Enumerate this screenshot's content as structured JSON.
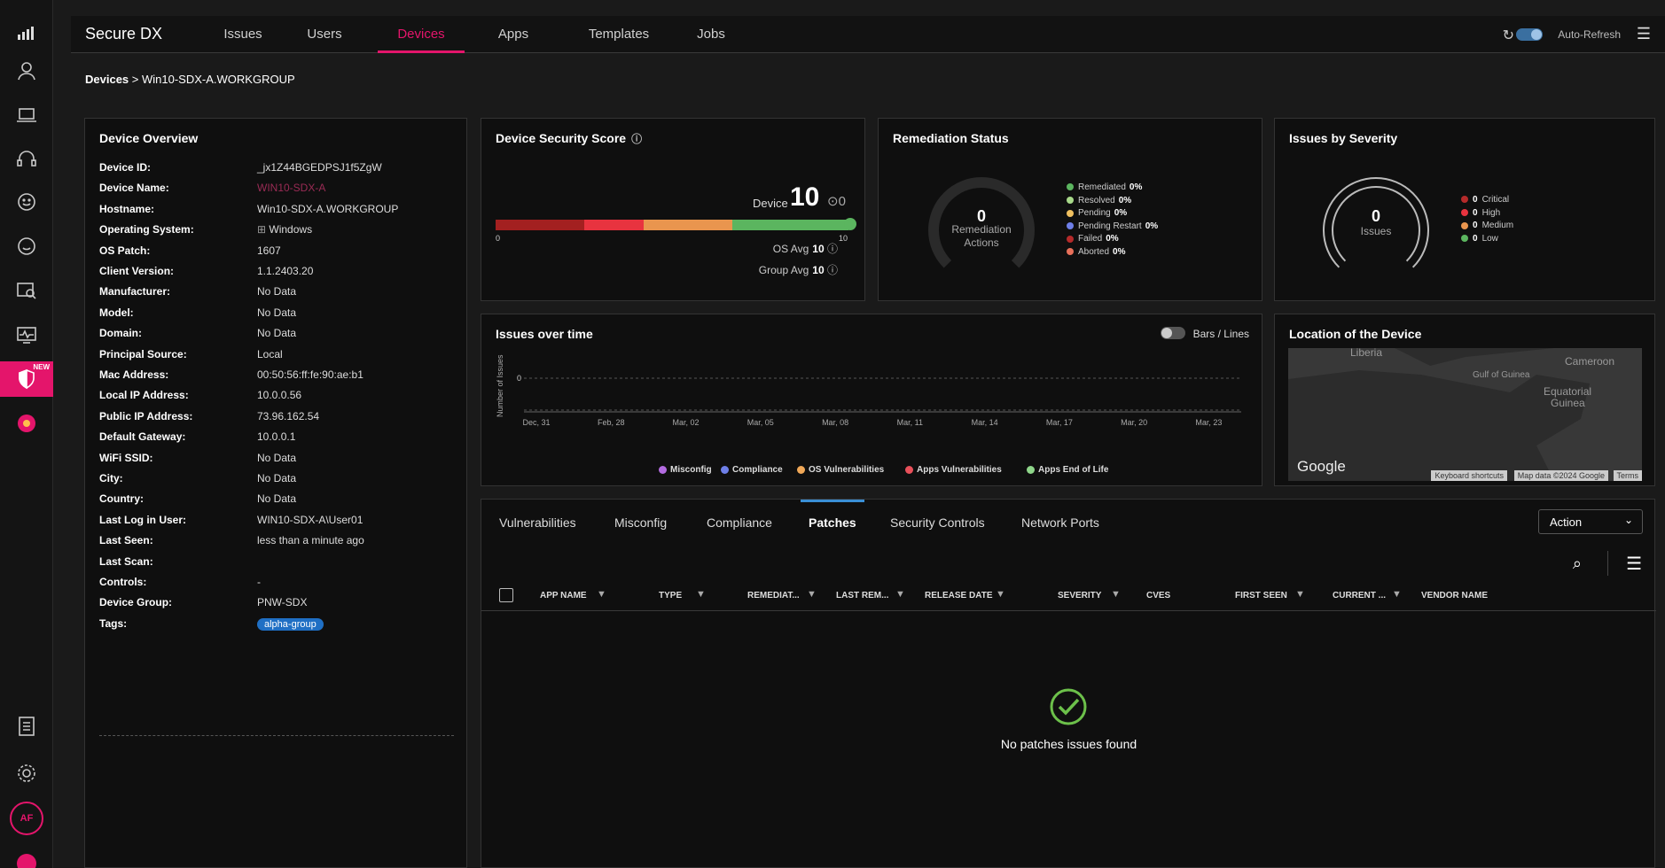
{
  "app": {
    "title": "Secure DX"
  },
  "nav": {
    "tabs": [
      {
        "label": "Issues"
      },
      {
        "label": "Users"
      },
      {
        "label": "Devices",
        "active": true
      },
      {
        "label": "Apps"
      },
      {
        "label": "Templates"
      },
      {
        "label": "Jobs"
      }
    ],
    "auto_refresh_label": "Auto-Refresh"
  },
  "rail": {
    "new_badge": "NEW",
    "avatar_initials": "AF"
  },
  "breadcrumb": {
    "root": "Devices",
    "separator": ">",
    "current": "Win10-SDX-A.WORKGROUP"
  },
  "overview": {
    "title": "Device Overview",
    "rows": [
      {
        "key": "Device ID:",
        "value": "_jx1Z44BGEDPSJ1f5ZgW"
      },
      {
        "key": "Device Name:",
        "value": "WIN10-SDX-A"
      },
      {
        "key": "Hostname:",
        "value": "Win10-SDX-A.WORKGROUP"
      },
      {
        "key": "Operating System:",
        "value": "Windows"
      },
      {
        "key": "OS Patch:",
        "value": "1607"
      },
      {
        "key": "Client Version:",
        "value": "1.1.2403.20"
      },
      {
        "key": "Manufacturer:",
        "value": "No Data"
      },
      {
        "key": "Model:",
        "value": "No Data"
      },
      {
        "key": "Domain:",
        "value": "No Data"
      },
      {
        "key": "Principal Source:",
        "value": "Local"
      },
      {
        "key": "Mac Address:",
        "value": "00:50:56:ff:fe:90:ae:b1"
      },
      {
        "key": "Local IP Address:",
        "value": "10.0.0.56"
      },
      {
        "key": "Public IP Address:",
        "value": "73.96.162.54"
      },
      {
        "key": "Default Gateway:",
        "value": "10.0.0.1"
      },
      {
        "key": "WiFi SSID:",
        "value": "No Data"
      },
      {
        "key": "City:",
        "value": "No Data"
      },
      {
        "key": "Country:",
        "value": "No Data"
      },
      {
        "key": "Last Log in User:",
        "value": "WIN10-SDX-A\\User01"
      },
      {
        "key": "Last Seen:",
        "value": "less than a minute ago"
      },
      {
        "key": "Last Scan:",
        "value": ""
      },
      {
        "key": "Controls:",
        "value": "-"
      },
      {
        "key": "Device Group:",
        "value": "PNW-SDX"
      },
      {
        "key": "Tags:",
        "value": "alpha-group"
      }
    ]
  },
  "score": {
    "title": "Device Security Score",
    "device_label": "Device",
    "device_value": "10",
    "delta": "⊙0",
    "scale_min": "0",
    "scale_max": "10",
    "os_avg_label": "OS Avg",
    "os_avg": "10",
    "group_avg_label": "Group Avg",
    "group_avg": "10",
    "colors": [
      "#a32020",
      "#e8333f",
      "#e9954e",
      "#5bb55f"
    ]
  },
  "remediation": {
    "title": "Remediation Status",
    "total": "0",
    "center_label_1": "Remediation",
    "center_label_2": "Actions",
    "legend": [
      {
        "label": "Remediated",
        "value": "0%",
        "color": "#5bb55f"
      },
      {
        "label": "Resolved",
        "value": "0%",
        "color": "#a8d98a"
      },
      {
        "label": "Pending",
        "value": "0%",
        "color": "#f0c060"
      },
      {
        "label": "Pending Restart",
        "value": "0%",
        "color": "#6e7fe8"
      },
      {
        "label": "Failed",
        "value": "0%",
        "color": "#b52a2a"
      },
      {
        "label": "Aborted",
        "value": "0%",
        "color": "#e8705a"
      }
    ]
  },
  "severity": {
    "title": "Issues by Severity",
    "total": "0",
    "center_label": "Issues",
    "legend": [
      {
        "label": "Critical",
        "value": "0",
        "color": "#b52a2a"
      },
      {
        "label": "High",
        "value": "0",
        "color": "#e8333f"
      },
      {
        "label": "Medium",
        "value": "0",
        "color": "#e9954e"
      },
      {
        "label": "Low",
        "value": "0",
        "color": "#5bb55f"
      }
    ]
  },
  "issues_over_time": {
    "title": "Issues over time",
    "toggle_label": "Bars / Lines"
  },
  "chart_data": {
    "type": "line",
    "x": [
      "Dec, 31",
      "Feb, 28",
      "Mar, 02",
      "Mar, 05",
      "Mar, 08",
      "Mar, 11",
      "Mar, 14",
      "Mar, 17",
      "Mar, 20",
      "Mar, 23"
    ],
    "ylabel": "Number of Issues",
    "yticks": [
      "0"
    ],
    "series": [
      {
        "name": "Misconfig",
        "color": "#b36be0",
        "values": []
      },
      {
        "name": "Compliance",
        "color": "#6e7fe8",
        "values": []
      },
      {
        "name": "OS Vulnerabilities",
        "color": "#f0a858",
        "values": []
      },
      {
        "name": "Apps Vulnerabilities",
        "color": "#e8505a",
        "values": []
      },
      {
        "name": "Apps End of Life",
        "color": "#8fd68a",
        "values": []
      }
    ]
  },
  "location": {
    "title": "Location of the Device",
    "labels": [
      "Liberia",
      "Gulf of Guinea",
      "Cameroon",
      "Equatorial",
      "Guinea"
    ],
    "logo": "Google",
    "attrib": [
      "Keyboard shortcuts",
      "Map data ©2024 Google",
      "Terms"
    ]
  },
  "detail_tabs": {
    "tabs": [
      {
        "label": "Vulnerabilities"
      },
      {
        "label": "Misconfig"
      },
      {
        "label": "Compliance"
      },
      {
        "label": "Patches",
        "active": true
      },
      {
        "label": "Security Controls"
      },
      {
        "label": "Network Ports"
      }
    ],
    "action_label": "Action",
    "columns": [
      "APP NAME",
      "TYPE",
      "REMEDIAT...",
      "LAST REM...",
      "RELEASE DATE",
      "SEVERITY",
      "CVES",
      "FIRST SEEN",
      "CURRENT ...",
      "VENDOR NAME"
    ],
    "empty_message": "No patches issues found"
  }
}
